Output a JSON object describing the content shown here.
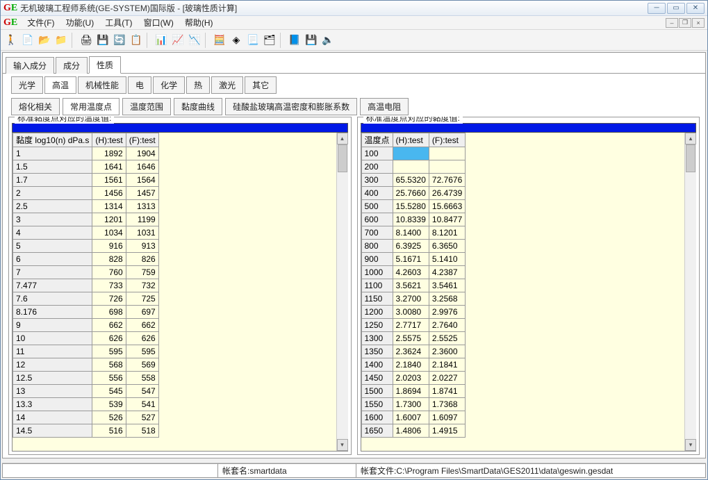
{
  "window": {
    "title": "无机玻璃工程师系统(GE-SYSTEM)国际版 -  [玻璃性质计算]"
  },
  "menu": {
    "file": "文件(F)",
    "func": "功能(U)",
    "tools": "工具(T)",
    "window": "窗口(W)",
    "help": "帮助(H)"
  },
  "primary_tabs": {
    "input": "输入成分",
    "comp": "成分",
    "prop": "性质"
  },
  "prop_tabs": {
    "optical": "光学",
    "hightemp": "高温",
    "mech": "机械性能",
    "elec": "电",
    "chem": "化学",
    "thermal": "热",
    "laser": "激光",
    "other": "其它"
  },
  "sub_tabs": {
    "melt": "熔化相关",
    "common": "常用温度点",
    "range": "温度范围",
    "visc_curve": "黏度曲线",
    "silicate": "硅酸盐玻璃高温密度和膨胀系数",
    "res": "高温电阻"
  },
  "panels": {
    "left_title": "标准黏度点对应的温度值:",
    "right_title": "标准温度点对应的黏度值:"
  },
  "left_table": {
    "headers": {
      "c0": "黏度 log10(n) dPa.s",
      "c1": "(H):test",
      "c2": "(F):test"
    },
    "rows": [
      {
        "a": "1",
        "h": "1892",
        "f": "1904"
      },
      {
        "a": "1.5",
        "h": "1641",
        "f": "1646"
      },
      {
        "a": "1.7",
        "h": "1561",
        "f": "1564"
      },
      {
        "a": "2",
        "h": "1456",
        "f": "1457"
      },
      {
        "a": "2.5",
        "h": "1314",
        "f": "1313"
      },
      {
        "a": "3",
        "h": "1201",
        "f": "1199"
      },
      {
        "a": "4",
        "h": "1034",
        "f": "1031"
      },
      {
        "a": "5",
        "h": "916",
        "f": "913"
      },
      {
        "a": "6",
        "h": "828",
        "f": "826"
      },
      {
        "a": "7",
        "h": "760",
        "f": "759"
      },
      {
        "a": "7.477",
        "h": "733",
        "f": "732"
      },
      {
        "a": "7.6",
        "h": "726",
        "f": "725"
      },
      {
        "a": "8.176",
        "h": "698",
        "f": "697"
      },
      {
        "a": "9",
        "h": "662",
        "f": "662"
      },
      {
        "a": "10",
        "h": "626",
        "f": "626"
      },
      {
        "a": "11",
        "h": "595",
        "f": "595"
      },
      {
        "a": "12",
        "h": "568",
        "f": "569"
      },
      {
        "a": "12.5",
        "h": "556",
        "f": "558"
      },
      {
        "a": "13",
        "h": "545",
        "f": "547"
      },
      {
        "a": "13.3",
        "h": "539",
        "f": "541"
      },
      {
        "a": "14",
        "h": "526",
        "f": "527"
      },
      {
        "a": "14.5",
        "h": "516",
        "f": "518"
      }
    ]
  },
  "right_table": {
    "headers": {
      "c0": "温度点",
      "c1": "(H):test",
      "c2": "(F):test"
    },
    "rows": [
      {
        "t": "100",
        "h": "",
        "f": ""
      },
      {
        "t": "200",
        "h": "",
        "f": ""
      },
      {
        "t": "300",
        "h": "65.5320",
        "f": "72.7676"
      },
      {
        "t": "400",
        "h": "25.7660",
        "f": "26.4739"
      },
      {
        "t": "500",
        "h": "15.5280",
        "f": "15.6663"
      },
      {
        "t": "600",
        "h": "10.8339",
        "f": "10.8477"
      },
      {
        "t": "700",
        "h": "8.1400",
        "f": "8.1201"
      },
      {
        "t": "800",
        "h": "6.3925",
        "f": "6.3650"
      },
      {
        "t": "900",
        "h": "5.1671",
        "f": "5.1410"
      },
      {
        "t": "1000",
        "h": "4.2603",
        "f": "4.2387"
      },
      {
        "t": "1100",
        "h": "3.5621",
        "f": "3.5461"
      },
      {
        "t": "1150",
        "h": "3.2700",
        "f": "3.2568"
      },
      {
        "t": "1200",
        "h": "3.0080",
        "f": "2.9976"
      },
      {
        "t": "1250",
        "h": "2.7717",
        "f": "2.7640"
      },
      {
        "t": "1300",
        "h": "2.5575",
        "f": "2.5525"
      },
      {
        "t": "1350",
        "h": "2.3624",
        "f": "2.3600"
      },
      {
        "t": "1400",
        "h": "2.1840",
        "f": "2.1841"
      },
      {
        "t": "1450",
        "h": "2.0203",
        "f": "2.0227"
      },
      {
        "t": "1500",
        "h": "1.8694",
        "f": "1.8741"
      },
      {
        "t": "1550",
        "h": "1.7300",
        "f": "1.7368"
      },
      {
        "t": "1600",
        "h": "1.6007",
        "f": "1.6097"
      },
      {
        "t": "1650",
        "h": "1.4806",
        "f": "1.4915"
      }
    ]
  },
  "status": {
    "account_label": "帐套名:smartdata",
    "file_label": "帐套文件:C:\\Program Files\\SmartData\\GES2011\\data\\geswin.gesdat"
  },
  "toolbar_icons": [
    "🚶",
    "📄",
    "📂",
    "📁",
    "|",
    "🖨",
    "💾",
    "🔄",
    "📋",
    "|",
    "📊",
    "📈",
    "📉",
    "|",
    "🧮",
    "◈",
    "📃",
    "🗂",
    "|",
    "📘",
    "💾",
    "🔈"
  ]
}
